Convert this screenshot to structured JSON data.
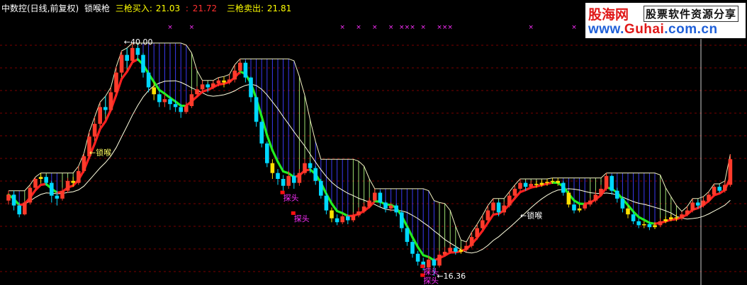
{
  "header": {
    "title": "中数控(日线,前复权)",
    "indicator": "锁喉枪",
    "buy_label": "三枪买入:",
    "buy_value1": "21.03",
    "buy_value2": "21.72",
    "sell_label": "三枪卖出:",
    "sell_value": "21.81"
  },
  "watermark": {
    "site_name": "股海网",
    "slogan": "股票软件资源分享",
    "url_prefix": "www.",
    "url_brand": "Guhai",
    "url_suffix": ".com.cn"
  },
  "colors": {
    "up": "#ff3b2b",
    "down": "#00d8ff",
    "neutral": "#ffe000",
    "ma_up": "#ff2020",
    "ma_down": "#22ee22",
    "slow": "#ffffe0",
    "hatch_blue": "#3a3af0",
    "hatch_green": "#9bdc70",
    "marker": "#ff30ff",
    "text": "#ffffff",
    "header_title": "#ffffff",
    "buy": "#ffff00",
    "buy2": "#ff3030",
    "sell": "#ffff00",
    "grid": "#7a0000"
  },
  "chart_data": {
    "type": "candlestick",
    "y_range": [
      16.0,
      41.5
    ],
    "high_mark": "40.00",
    "low_mark": "16.36",
    "annotations": [
      {
        "text": "←锁喉",
        "x_index": 15,
        "price": 28.6,
        "color": "#ffff60"
      },
      {
        "text": "←锁喉",
        "x_index": 95,
        "price": 22.2,
        "color": "#ffffff"
      },
      {
        "text": "探头",
        "x_index": 51,
        "price": 24.0,
        "color": "#ff30ff"
      },
      {
        "text": "探头",
        "x_index": 53,
        "price": 21.9,
        "color": "#ff30ff"
      },
      {
        "text": "探头",
        "x_index": 77,
        "price": 16.5,
        "color": "#ff30ff"
      },
      {
        "text": "探头",
        "x_index": 77,
        "price": 15.6,
        "color": "#ff30ff"
      }
    ],
    "x_markers": [
      30,
      34,
      62,
      65,
      68,
      71,
      73,
      74,
      75,
      77,
      80,
      81,
      82,
      97,
      105
    ],
    "candles": [
      [
        24.0,
        24.6,
        25.0,
        23.6
      ],
      [
        24.6,
        23.5,
        25.0,
        23.0
      ],
      [
        23.5,
        22.6,
        23.8,
        22.3
      ],
      [
        22.6,
        23.8,
        24.0,
        22.5
      ],
      [
        23.8,
        25.3,
        25.6,
        23.6
      ],
      [
        25.3,
        26.2,
        26.4,
        25.0
      ],
      [
        26.2,
        26.4,
        26.8,
        25.8
      ],
      [
        26.4,
        25.8,
        26.6,
        25.5
      ],
      [
        25.8,
        24.5,
        26.0,
        23.8
      ],
      [
        24.5,
        24.2,
        25.0,
        23.5
      ],
      [
        24.2,
        25.0,
        25.3,
        24.0
      ],
      [
        25.0,
        26.0,
        26.3,
        24.8
      ],
      [
        26.0,
        25.8,
        26.4,
        25.4
      ],
      [
        25.8,
        27.0,
        27.5,
        25.6
      ],
      [
        27.0,
        28.5,
        28.8,
        26.8
      ],
      [
        28.5,
        30.5,
        31.0,
        28.2
      ],
      [
        30.5,
        31.8,
        32.5,
        30.2
      ],
      [
        31.8,
        33.5,
        34.0,
        31.5
      ],
      [
        33.5,
        33.2,
        34.6,
        32.8
      ],
      [
        33.2,
        35.0,
        35.5,
        33.0
      ],
      [
        35.0,
        37.0,
        37.6,
        34.5
      ],
      [
        37.0,
        38.8,
        39.2,
        36.8
      ],
      [
        38.8,
        38.2,
        39.5,
        37.5
      ],
      [
        38.2,
        39.5,
        40.0,
        38.0
      ],
      [
        39.5,
        38.8,
        39.8,
        38.2
      ],
      [
        38.8,
        37.0,
        39.0,
        36.5
      ],
      [
        37.0,
        35.5,
        37.2,
        35.0
      ],
      [
        35.5,
        34.8,
        36.0,
        34.2
      ],
      [
        34.8,
        34.0,
        35.2,
        33.5
      ],
      [
        34.0,
        34.3,
        34.8,
        33.5
      ],
      [
        34.3,
        33.8,
        34.6,
        33.2
      ],
      [
        33.8,
        33.5,
        34.2,
        33.0
      ],
      [
        33.5,
        33.0,
        33.8,
        32.4
      ],
      [
        33.0,
        33.6,
        34.0,
        32.8
      ],
      [
        33.6,
        34.8,
        35.2,
        33.4
      ],
      [
        34.8,
        35.3,
        35.6,
        34.5
      ],
      [
        35.3,
        35.8,
        36.2,
        35.0
      ],
      [
        35.8,
        35.5,
        36.0,
        35.0
      ],
      [
        35.5,
        35.9,
        36.2,
        35.3
      ],
      [
        35.9,
        36.2,
        36.5,
        35.6
      ],
      [
        36.2,
        36.0,
        36.6,
        35.5
      ],
      [
        36.0,
        36.3,
        36.8,
        35.8
      ],
      [
        36.3,
        37.2,
        37.8,
        36.0
      ],
      [
        37.2,
        38.0,
        38.4,
        36.8
      ],
      [
        38.0,
        36.5,
        38.2,
        36.0
      ],
      [
        36.5,
        34.5,
        36.6,
        34.0
      ],
      [
        34.5,
        32.0,
        34.7,
        31.5
      ],
      [
        32.0,
        29.8,
        32.2,
        29.4
      ],
      [
        29.8,
        27.8,
        30.0,
        27.4
      ],
      [
        27.8,
        26.8,
        28.2,
        26.2
      ],
      [
        26.8,
        26.2,
        27.2,
        25.6
      ],
      [
        26.2,
        25.5,
        26.6,
        24.8
      ],
      [
        25.5,
        26.5,
        27.0,
        25.2
      ],
      [
        26.5,
        25.8,
        26.8,
        25.2
      ],
      [
        25.8,
        26.8,
        27.2,
        25.5
      ],
      [
        26.8,
        27.8,
        28.2,
        26.6
      ],
      [
        27.8,
        27.3,
        28.0,
        26.8
      ],
      [
        27.3,
        26.0,
        27.5,
        25.6
      ],
      [
        26.0,
        24.5,
        26.2,
        24.2
      ],
      [
        24.5,
        23.0,
        24.8,
        22.6
      ],
      [
        23.0,
        22.2,
        23.3,
        21.8
      ],
      [
        22.2,
        21.8,
        22.6,
        21.5
      ],
      [
        21.8,
        22.4,
        22.7,
        21.6
      ],
      [
        22.4,
        22.0,
        22.6,
        21.6
      ],
      [
        22.0,
        22.5,
        22.8,
        21.8
      ],
      [
        22.5,
        22.9,
        23.3,
        22.3
      ],
      [
        22.9,
        23.4,
        23.8,
        22.7
      ],
      [
        23.4,
        24.0,
        24.3,
        23.2
      ],
      [
        24.0,
        24.8,
        25.2,
        23.8
      ],
      [
        24.8,
        23.8,
        25.0,
        23.4
      ],
      [
        23.8,
        23.2,
        24.0,
        22.8
      ],
      [
        23.2,
        23.5,
        23.8,
        22.9
      ],
      [
        23.5,
        22.8,
        23.7,
        22.4
      ],
      [
        22.8,
        21.2,
        23.0,
        20.8
      ],
      [
        21.2,
        19.8,
        21.4,
        19.4
      ],
      [
        19.8,
        18.6,
        20.0,
        18.2
      ],
      [
        18.6,
        17.8,
        18.9,
        17.4
      ],
      [
        17.8,
        17.2,
        18.2,
        16.9
      ],
      [
        17.2,
        18.0,
        18.4,
        16.6
      ],
      [
        18.0,
        17.4,
        18.2,
        16.36
      ],
      [
        17.4,
        18.5,
        18.9,
        17.2
      ],
      [
        18.5,
        18.8,
        19.3,
        18.3
      ],
      [
        18.8,
        19.2,
        19.6,
        18.6
      ],
      [
        19.2,
        18.8,
        19.4,
        18.5
      ],
      [
        18.8,
        19.0,
        19.3,
        18.6
      ],
      [
        19.0,
        19.4,
        19.8,
        18.8
      ],
      [
        19.4,
        20.3,
        20.8,
        19.2
      ],
      [
        20.3,
        21.2,
        21.6,
        20.0
      ],
      [
        21.2,
        22.0,
        22.5,
        21.0
      ],
      [
        22.0,
        23.0,
        23.5,
        21.8
      ],
      [
        23.0,
        23.8,
        24.2,
        22.8
      ],
      [
        23.8,
        22.8,
        24.0,
        22.4
      ],
      [
        22.8,
        23.5,
        23.9,
        22.5
      ],
      [
        23.5,
        24.5,
        24.9,
        23.3
      ],
      [
        24.5,
        25.2,
        25.6,
        24.3
      ],
      [
        25.2,
        25.8,
        26.2,
        25.0
      ],
      [
        25.8,
        25.4,
        26.0,
        25.0
      ],
      [
        25.4,
        25.7,
        26.0,
        25.2
      ],
      [
        25.7,
        25.6,
        26.0,
        25.3
      ],
      [
        25.6,
        25.8,
        26.1,
        25.4
      ],
      [
        25.8,
        25.9,
        26.2,
        25.5
      ],
      [
        25.9,
        26.0,
        26.3,
        25.7
      ],
      [
        26.0,
        25.8,
        26.3,
        25.5
      ],
      [
        25.8,
        24.8,
        26.0,
        24.5
      ],
      [
        24.8,
        23.6,
        25.0,
        23.3
      ],
      [
        23.6,
        23.0,
        23.9,
        22.7
      ],
      [
        23.0,
        23.2,
        23.6,
        22.8
      ],
      [
        23.2,
        23.6,
        23.9,
        23.0
      ],
      [
        23.6,
        24.0,
        24.3,
        23.4
      ],
      [
        24.0,
        24.6,
        25.0,
        23.8
      ],
      [
        24.6,
        25.2,
        25.6,
        24.4
      ],
      [
        25.2,
        26.5,
        26.8,
        25.0
      ],
      [
        26.5,
        25.0,
        26.6,
        24.6
      ],
      [
        25.0,
        24.2,
        25.3,
        23.8
      ],
      [
        24.2,
        23.2,
        24.4,
        22.8
      ],
      [
        23.2,
        22.6,
        23.5,
        22.2
      ],
      [
        22.6,
        21.9,
        22.9,
        21.6
      ],
      [
        21.9,
        21.5,
        22.2,
        21.2
      ],
      [
        21.5,
        21.6,
        21.9,
        21.2
      ],
      [
        21.6,
        21.3,
        21.8,
        21.0
      ],
      [
        21.3,
        21.5,
        21.8,
        21.1
      ],
      [
        21.5,
        21.9,
        22.2,
        21.3
      ],
      [
        21.9,
        22.1,
        22.4,
        21.7
      ],
      [
        22.1,
        22.3,
        22.6,
        21.9
      ],
      [
        22.3,
        22.2,
        22.6,
        21.9
      ],
      [
        22.2,
        22.6,
        22.9,
        22.0
      ],
      [
        22.6,
        23.0,
        23.4,
        22.4
      ],
      [
        23.0,
        23.8,
        24.2,
        22.8
      ],
      [
        23.8,
        23.5,
        24.1,
        23.2
      ],
      [
        23.5,
        24.0,
        24.4,
        23.3
      ],
      [
        24.0,
        24.6,
        24.9,
        23.8
      ],
      [
        24.6,
        25.4,
        25.7,
        24.4
      ],
      [
        25.4,
        25.0,
        25.6,
        24.8
      ],
      [
        25.0,
        25.6,
        26.0,
        24.8
      ],
      [
        25.6,
        28.2,
        28.7,
        25.4
      ]
    ]
  }
}
